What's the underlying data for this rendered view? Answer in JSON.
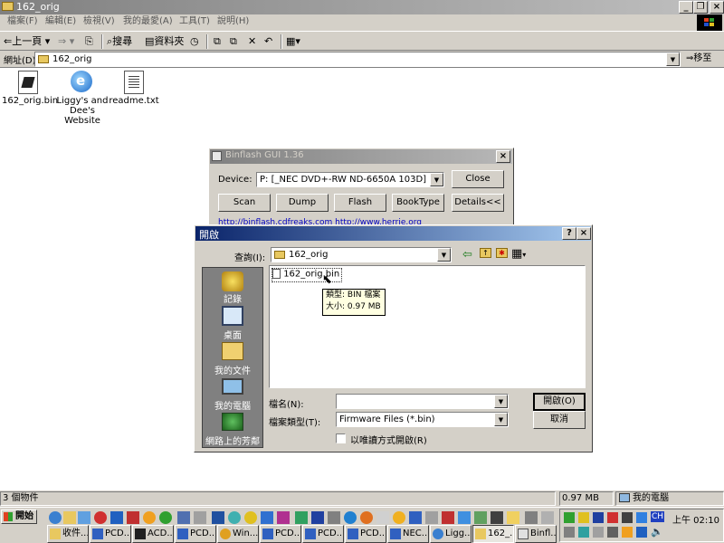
{
  "explorer": {
    "title": "162_orig",
    "menu": [
      "檔案(F)",
      "編輯(E)",
      "檢視(V)",
      "我的最愛(A)",
      "工具(T)",
      "說明(H)"
    ],
    "toolbar": {
      "back": "上一頁",
      "search": "搜尋",
      "folders": "資料夾"
    },
    "address_label": "網址(D)",
    "address_value": "162_orig",
    "go": "移至",
    "files": [
      {
        "name": "162_orig.bin",
        "icon": "bin-file-icon"
      },
      {
        "name": "Liggy's and Dee's Website",
        "icon": "ie-shortcut-icon"
      },
      {
        "name": "readme.txt",
        "icon": "text-file-icon"
      }
    ],
    "status": {
      "objects": "3 個物件",
      "size": "0.97 MB",
      "zone": "我的電腦"
    }
  },
  "binflash": {
    "title": "Binflash GUI 1.36",
    "device_label": "Device:",
    "device_value": "P: [_NEC     DVD+-RW ND-6650A 103D]",
    "close": "Close",
    "buttons": [
      "Scan",
      "Dump",
      "Flash",
      "BookType",
      "Details<<"
    ],
    "link": "http://binflash.cdfreaks.com  http://www.herrie.org"
  },
  "open_dialog": {
    "title": "開啟",
    "lookin_label": "查詢(I):",
    "lookin_value": "162_orig",
    "places": [
      "記錄",
      "桌面",
      "我的文件",
      "我的電腦",
      "網路上的芳鄰"
    ],
    "file_item": "162_orig.bin",
    "tooltip": {
      "type": "類型: BIN 檔案",
      "size": "大小: 0.97 MB"
    },
    "filename_label": "檔名(N):",
    "filename_value": "",
    "filetype_label": "檔案類型(T):",
    "filetype_value": "Firmware Files (*.bin)",
    "readonly": "以唯讀方式開啟(R)",
    "open": "開啟(O)",
    "cancel": "取消"
  },
  "taskbar": {
    "start": "開始",
    "tasks": [
      "收件...",
      "PCD...",
      "ACD...",
      "PCD...",
      "Win...",
      "PCD...",
      "PCD...",
      "PCD...",
      "NEC...",
      "Ligg...",
      "162_...",
      "Binfl..."
    ],
    "clock": "上午 02:10",
    "ime": "CH"
  },
  "colors": {
    "title_active": "#0a246a",
    "title_active_end": "#a6caf0",
    "title_inactive": "#808080",
    "face": "#d4d0c8"
  }
}
